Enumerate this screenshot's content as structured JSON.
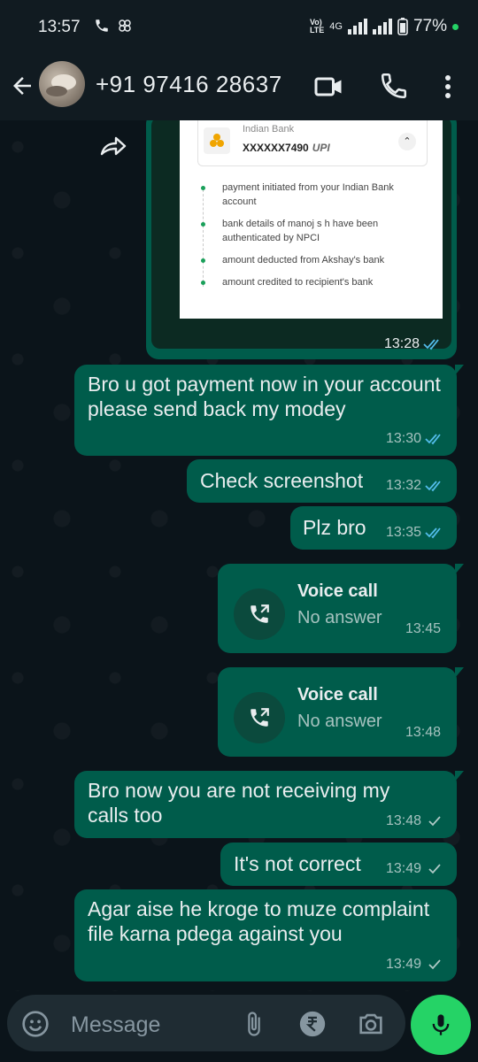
{
  "status": {
    "time": "13:57",
    "battery": "77%",
    "network": "4G"
  },
  "header": {
    "contact": "+91 97416 28637"
  },
  "screenshot": {
    "bank_name": "Indian Bank",
    "account": "XXXXXX7490",
    "upi_label": "UPI",
    "steps": [
      "payment initiated from your Indian Bank account",
      "bank details of manoj s h have been authenticated by NPCI",
      "amount deducted from Akshay's bank",
      "amount credited to recipient's bank"
    ],
    "time": "13:28"
  },
  "messages": [
    {
      "text": "Bro u got payment now in your account please send back my modey",
      "time": "13:30",
      "ticks": "read"
    },
    {
      "text": "Check screenshot",
      "time": "13:32",
      "ticks": "read"
    },
    {
      "text": "Plz bro",
      "time": "13:35",
      "ticks": "read"
    },
    {
      "call_title": "Voice call",
      "call_status": "No answer",
      "time": "13:45"
    },
    {
      "call_title": "Voice call",
      "call_status": "No answer",
      "time": "13:48"
    },
    {
      "text": "Bro now you are not receiving my calls too",
      "time": "13:48",
      "ticks": "delivered"
    },
    {
      "text": "It's not correct",
      "time": "13:49",
      "ticks": "delivered"
    },
    {
      "text": "Agar aise he kroge to muze complaint file karna pdega against you",
      "time": "13:49",
      "ticks": "delivered"
    }
  ],
  "input": {
    "placeholder": "Message"
  },
  "colors": {
    "bubble": "#005c4b",
    "background": "#0b141a",
    "header": "#111b21",
    "accent": "#25d366",
    "read_tick": "#53bdeb"
  }
}
